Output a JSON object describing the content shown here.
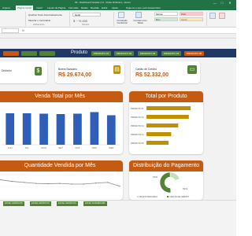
{
  "window": {
    "title": "03 - Dashboard Vendas 2.0 - Vídeo Dinâmico - Excel",
    "buttons": [
      "—",
      "□",
      "✕"
    ]
  },
  "ribbon_tabs": [
    "Arquivo",
    "Página Inicial",
    "Inserir",
    "Layout da Página",
    "Fórmulas",
    "Dados",
    "Revisão",
    "Exibir",
    "Ajuda",
    "Diga-me o que você deseja fazer"
  ],
  "ribbon": {
    "wrap_text": "Quebrar Texto Automaticamente",
    "merge_center": "Mesclar e Centralizar",
    "number_format": "Geral",
    "alignment_group": "Alinhamento",
    "number_group": "Número",
    "conditional_format": "Formatação Condicional",
    "format_as_table": "Formatar como Tabela",
    "styles": [
      "Normal",
      "Ruim",
      "Bom",
      "Neutro"
    ]
  },
  "nav": {
    "title": "Produto",
    "buttons": [
      "",
      "",
      "",
      "PRODUTO 01",
      "PRODUTO 02",
      "PRODUTO 03",
      "PRODUTO 04",
      "PRODUTO 05"
    ],
    "colors": [
      "#c55a11",
      "#548235",
      "#548235",
      "#548235",
      "#548235",
      "#548235",
      "#548235",
      "#c55a11"
    ]
  },
  "kpis": [
    {
      "label": "Dinheiro",
      "value": "",
      "icon": "cash-icon",
      "color": "#548235"
    },
    {
      "label": "Boleto Bancário",
      "value": "R$ 29.674,00",
      "icon": "barcode-icon",
      "color": "#bf9000"
    },
    {
      "label": "Cartão de Crédito",
      "value": "R$ 52.332,00",
      "icon": "card-icon",
      "color": "#548235"
    }
  ],
  "panels": {
    "monthly_sales": "Venda Total por Mês",
    "by_product": "Total por Produto",
    "qty_month": "Quantidade Vendida por Mês",
    "payment": "Distribuição do Pagamento"
  },
  "chart_data": [
    {
      "type": "bar",
      "title": "Venda Total por Mês",
      "categories": [
        "JUN",
        "JUL",
        "AGO",
        "SET",
        "OUT",
        "NOV",
        "DEZ"
      ],
      "values": [
        80,
        80,
        79,
        78,
        79,
        83,
        75
      ],
      "ylim": [
        0,
        100
      ],
      "color": "#2e5eb8"
    },
    {
      "type": "bar",
      "title": "Total por Produto",
      "categories": [
        "PRODUTO 01",
        "PRODUTO 02",
        "PRODUTO 03",
        "PRODUTO 04",
        "PRODUTO 05"
      ],
      "values": [
        100,
        96,
        72,
        56,
        50
      ],
      "ylim": [
        0,
        100
      ],
      "color": "#bf9000"
    },
    {
      "type": "line",
      "title": "Quantidade Vendida por Mês",
      "values": [
        55,
        50,
        47,
        44,
        43,
        44,
        42,
        42,
        45,
        47,
        36
      ],
      "ylim": [
        0,
        70
      ],
      "color": "#8c8c8c"
    },
    {
      "type": "pie",
      "title": "Distribuição do Pagamento",
      "labels": [
        "",
        "",
        ""
      ],
      "values": [
        19,
        30,
        51
      ],
      "percent_labels": [
        "19%",
        "",
        "51%"
      ],
      "legend": [
        "BOLETO BANCÁRIO",
        "CARTÃO DE CRÉDITO"
      ],
      "colors": [
        "#c5e0b4",
        "#ffffff",
        "#548235"
      ]
    }
  ],
  "sheet_tabs": [
    "EXCEL GRÁFICOS",
    "EXCEL GRÁFICOS",
    "EXCEL GRÁFICOS",
    "EXCEL DASHBOARD"
  ]
}
